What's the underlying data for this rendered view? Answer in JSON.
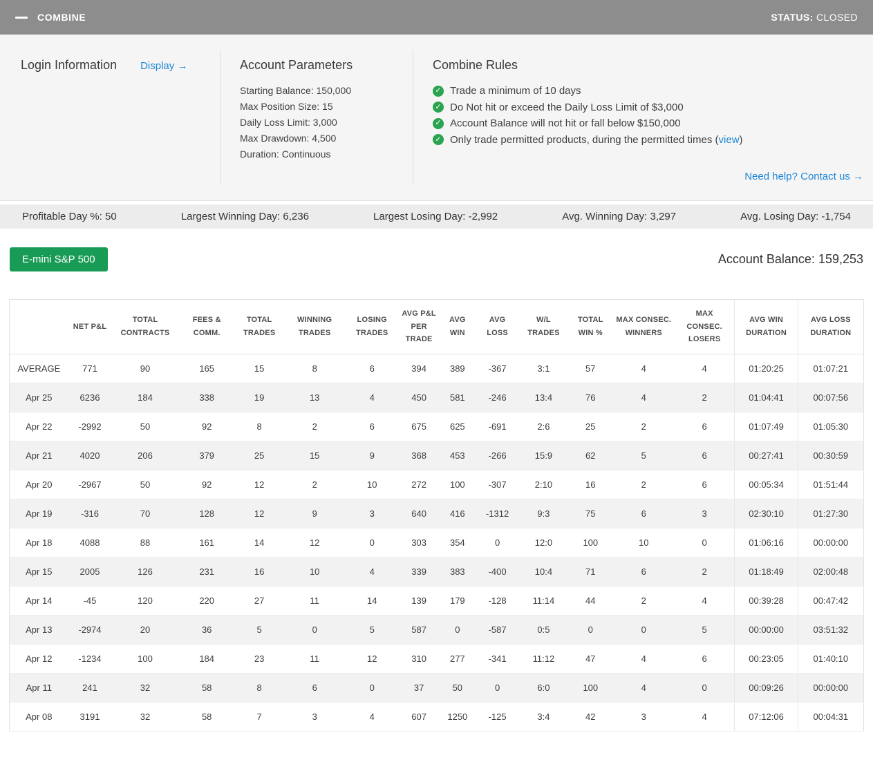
{
  "colors": {
    "topbar_bg": "#8d8d8d",
    "accent_blue": "#1d86d8",
    "brand_green": "#189b55",
    "check_green": "#2aa44e",
    "row_stripe": "#f2f2f2"
  },
  "topbar": {
    "title": "COMBINE",
    "status_label": "STATUS:",
    "status_value": "CLOSED"
  },
  "login": {
    "title": "Login Information",
    "display_link": "Display →"
  },
  "account_parameters": {
    "title": "Account Parameters",
    "lines": [
      "Starting Balance: 150,000",
      "Max Position Size: 15",
      "Daily Loss Limit: 3,000",
      "Max Drawdown: 4,500",
      "Duration: Continuous"
    ]
  },
  "combine_rules": {
    "title": "Combine Rules",
    "rules": [
      {
        "before": "Trade a minimum of 10 days",
        "link": "",
        "after": ""
      },
      {
        "before": "Do Not hit or exceed the Daily Loss Limit of $3,000",
        "link": "",
        "after": ""
      },
      {
        "before": "Account Balance will not hit or fall below $150,000",
        "link": "",
        "after": ""
      },
      {
        "before": "Only trade permitted products, during the permitted times (",
        "link": "view",
        "after": ")"
      }
    ]
  },
  "help_link": "Need help? Contact us →",
  "stats": [
    "Profitable Day %: 50",
    "Largest Winning Day: 6,236",
    "Largest Losing Day: -2,992",
    "Avg. Winning Day: 3,297",
    "Avg. Losing Day: -1,754"
  ],
  "toolbar": {
    "product_button": "E-mini S&P 500",
    "account_balance": "Account Balance: 159,253"
  },
  "table": {
    "headers": [
      "",
      "NET P&L",
      "TOTAL CONTRACTS",
      "FEES & COMM.",
      "TOTAL TRADES",
      "WINNING TRADES",
      "LOSING TRADES",
      "AVG P&L PER TRADE",
      "AVG WIN",
      "AVG LOSS",
      "W/L TRADES",
      "TOTAL WIN %",
      "MAX CONSEC. WINNERS",
      "MAX CONSEC. LOSERS",
      "AVG WIN DURATION",
      "AVG LOSS DURATION"
    ],
    "rows": [
      [
        "AVERAGE",
        "771",
        "90",
        "165",
        "15",
        "8",
        "6",
        "394",
        "389",
        "-367",
        "3:1",
        "57",
        "4",
        "4",
        "01:20:25",
        "01:07:21"
      ],
      [
        "Apr 25",
        "6236",
        "184",
        "338",
        "19",
        "13",
        "4",
        "450",
        "581",
        "-246",
        "13:4",
        "76",
        "4",
        "2",
        "01:04:41",
        "00:07:56"
      ],
      [
        "Apr 22",
        "-2992",
        "50",
        "92",
        "8",
        "2",
        "6",
        "675",
        "625",
        "-691",
        "2:6",
        "25",
        "2",
        "6",
        "01:07:49",
        "01:05:30"
      ],
      [
        "Apr 21",
        "4020",
        "206",
        "379",
        "25",
        "15",
        "9",
        "368",
        "453",
        "-266",
        "15:9",
        "62",
        "5",
        "6",
        "00:27:41",
        "00:30:59"
      ],
      [
        "Apr 20",
        "-2967",
        "50",
        "92",
        "12",
        "2",
        "10",
        "272",
        "100",
        "-307",
        "2:10",
        "16",
        "2",
        "6",
        "00:05:34",
        "01:51:44"
      ],
      [
        "Apr 19",
        "-316",
        "70",
        "128",
        "12",
        "9",
        "3",
        "640",
        "416",
        "-1312",
        "9:3",
        "75",
        "6",
        "3",
        "02:30:10",
        "01:27:30"
      ],
      [
        "Apr 18",
        "4088",
        "88",
        "161",
        "14",
        "12",
        "0",
        "303",
        "354",
        "0",
        "12:0",
        "100",
        "10",
        "0",
        "01:06:16",
        "00:00:00"
      ],
      [
        "Apr 15",
        "2005",
        "126",
        "231",
        "16",
        "10",
        "4",
        "339",
        "383",
        "-400",
        "10:4",
        "71",
        "6",
        "2",
        "01:18:49",
        "02:00:48"
      ],
      [
        "Apr 14",
        "-45",
        "120",
        "220",
        "27",
        "11",
        "14",
        "139",
        "179",
        "-128",
        "11:14",
        "44",
        "2",
        "4",
        "00:39:28",
        "00:47:42"
      ],
      [
        "Apr 13",
        "-2974",
        "20",
        "36",
        "5",
        "0",
        "5",
        "587",
        "0",
        "-587",
        "0:5",
        "0",
        "0",
        "5",
        "00:00:00",
        "03:51:32"
      ],
      [
        "Apr 12",
        "-1234",
        "100",
        "184",
        "23",
        "11",
        "12",
        "310",
        "277",
        "-341",
        "11:12",
        "47",
        "4",
        "6",
        "00:23:05",
        "01:40:10"
      ],
      [
        "Apr 11",
        "241",
        "32",
        "58",
        "8",
        "6",
        "0",
        "37",
        "50",
        "0",
        "6:0",
        "100",
        "4",
        "0",
        "00:09:26",
        "00:00:00"
      ],
      [
        "Apr 08",
        "3191",
        "32",
        "58",
        "7",
        "3",
        "4",
        "607",
        "1250",
        "-125",
        "3:4",
        "42",
        "3",
        "4",
        "07:12:06",
        "00:04:31"
      ]
    ]
  }
}
